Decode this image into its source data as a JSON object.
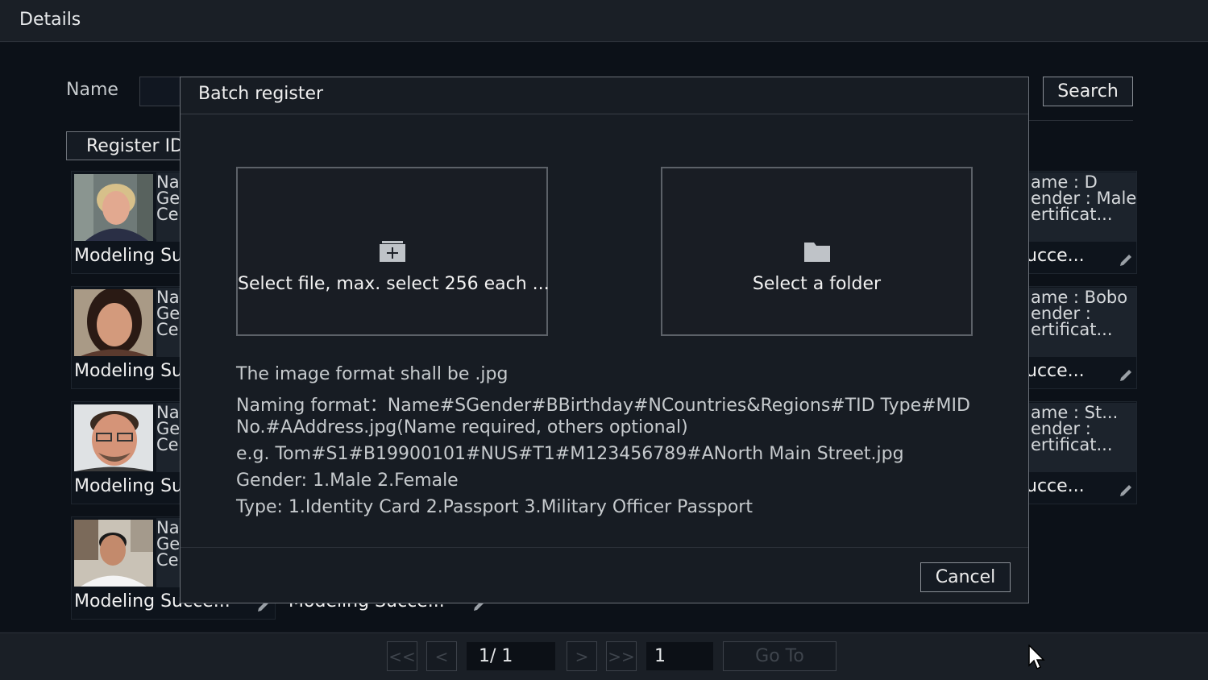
{
  "window": {
    "title": "Details"
  },
  "filter": {
    "name_label": "Name",
    "name_value": "",
    "search_label": "Search",
    "register_id_label": "Register ID"
  },
  "cards_left": [
    {
      "info": [
        "Na",
        "Ge",
        "Ce"
      ],
      "status": "Modeling Su"
    },
    {
      "info": [
        "Na",
        "Ge",
        "Ce"
      ],
      "status": "Modeling Su"
    },
    {
      "info": [
        "Na",
        "Ge",
        "Ce"
      ],
      "status": "Modeling Su"
    },
    {
      "info": [
        "Na",
        "Ge",
        "Ce"
      ],
      "status": "Modeling Succe..."
    }
  ],
  "cards_right": [
    {
      "info": [
        "ame : D",
        "ender : Male",
        "ertificat..."
      ],
      "status": "ucce..."
    },
    {
      "info": [
        "ame : Bobo",
        "ender :",
        "ertificat..."
      ],
      "status": "ucce..."
    },
    {
      "info": [
        "ame : St...",
        "ender :",
        "ertificat..."
      ],
      "status": "ucce..."
    }
  ],
  "card_mid_bottom": {
    "status": "Modeling Succe..."
  },
  "pagination": {
    "first": "<<",
    "prev": "<",
    "page_display": "1/  1",
    "next": ">",
    "last": ">>",
    "page_input": "1",
    "goto_label": "Go To"
  },
  "modal": {
    "title": "Batch register",
    "select_file_label": "Select file, max. select 256 each ...",
    "select_folder_label": "Select a folder",
    "notes": [
      "The image format shall be  .jpg",
      " Naming format：Name#SGender#BBirthday#NCountries&Regions#TID Type#MID",
      " No.#AAddress.jpg(Name required, others optional)",
      "e.g. Tom#S1#B19900101#NUS#T1#M123456789#ANorth Main Street.jpg",
      "Gender: 1.Male 2.Female",
      "Type: 1.Identity Card 2.Passport 3.Military Officer Passport"
    ],
    "cancel_label": "Cancel"
  },
  "colors": {
    "background": "#0c1118",
    "bar": "#1a1f26",
    "modal": "#171c23",
    "border": "#6b7078"
  }
}
